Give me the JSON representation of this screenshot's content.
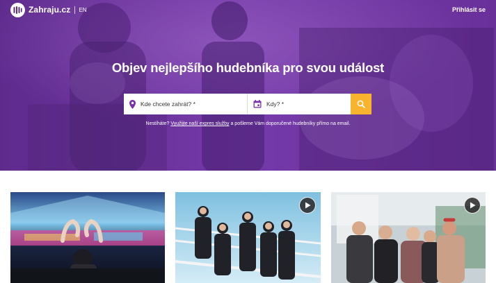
{
  "header": {
    "brand": "Zahraju.cz",
    "language": "EN",
    "login_label": "Přihlásit se"
  },
  "hero": {
    "headline": "Objev nejlepšího hudebníka pro svou událost"
  },
  "search": {
    "where_placeholder": "Kde chcete zahrát? *",
    "when_placeholder": "Kdy? *"
  },
  "hint": {
    "prefix": "Nestíháte?",
    "link": "Využijte naší expres služby",
    "suffix": "a pošleme Vám doporučené hudebníky přímo na email."
  },
  "icons": {
    "logo": "zahraju-logo-icon",
    "where": "map-pin-icon",
    "when": "calendar-icon",
    "search": "search-icon",
    "play": "play-icon"
  },
  "colors": {
    "hero_purple": "#6a3a97",
    "accent_yellow": "#f9b42d",
    "icon_purple": "#7b2fa8"
  },
  "cards": [
    {
      "has_play": false
    },
    {
      "has_play": true
    },
    {
      "has_play": true
    }
  ]
}
